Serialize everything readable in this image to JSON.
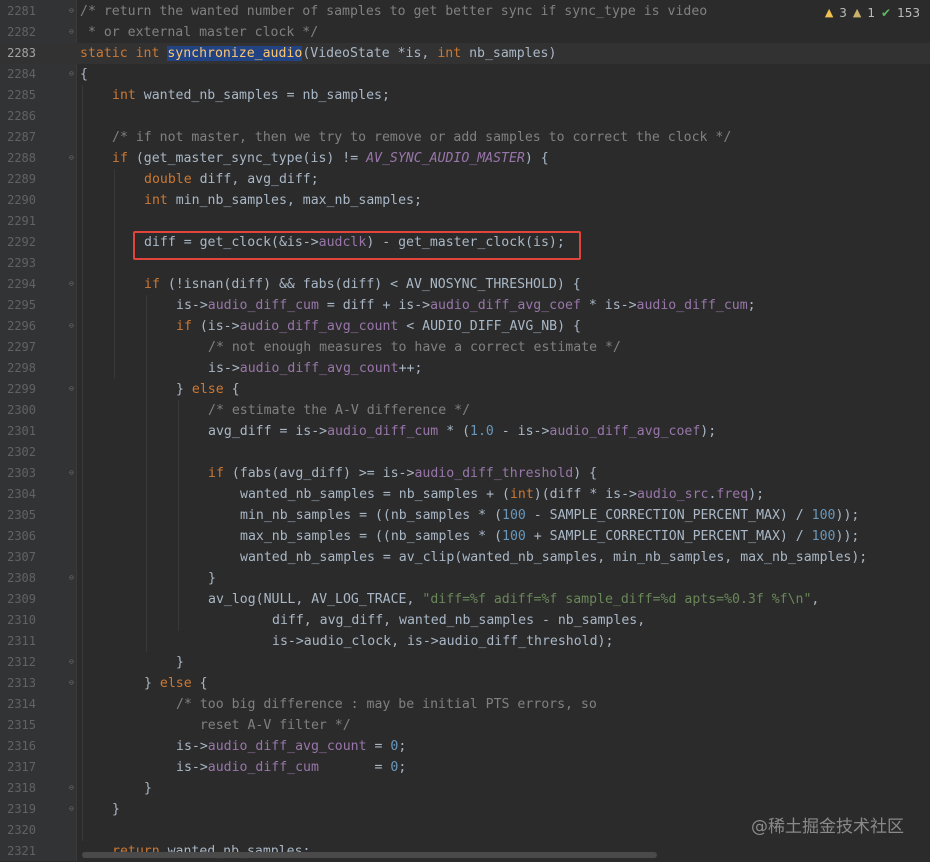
{
  "inspections": {
    "warnings": "3",
    "weak_warnings": "1",
    "typos": "153"
  },
  "watermark": "@稀土掘金技术社区",
  "lines": [
    {
      "n": "2281",
      "fold": "⊖",
      "indent": 0,
      "tokens": [
        [
          "cm",
          "/* return the wanted number of samples to get better sync if sync_type is video"
        ]
      ]
    },
    {
      "n": "2282",
      "fold": "⊖",
      "indent": 0,
      "tokens": [
        [
          "cm",
          " * or external master clock */"
        ]
      ]
    },
    {
      "n": "2283",
      "fold": "",
      "indent": 0,
      "current": true,
      "tokens": [
        [
          "kw",
          "static "
        ],
        [
          "kw",
          "int "
        ],
        [
          "hl",
          "synchronize_audio"
        ],
        [
          "",
          "(VideoState *is, "
        ],
        [
          "kw",
          "int "
        ],
        [
          "",
          "nb_samples)"
        ]
      ]
    },
    {
      "n": "2284",
      "fold": "⊖",
      "indent": 0,
      "tokens": [
        [
          "",
          "{"
        ]
      ]
    },
    {
      "n": "2285",
      "fold": "",
      "indent": 1,
      "tokens": [
        [
          "kw",
          "int "
        ],
        [
          "",
          "wanted_nb_samples = nb_samples;"
        ]
      ]
    },
    {
      "n": "2286",
      "fold": "",
      "indent": 0,
      "tokens": []
    },
    {
      "n": "2287",
      "fold": "",
      "indent": 1,
      "tokens": [
        [
          "cm",
          "/* if not master, then we try to remove or add samples to correct the clock */"
        ]
      ]
    },
    {
      "n": "2288",
      "fold": "⊖",
      "indent": 1,
      "tokens": [
        [
          "kw",
          "if "
        ],
        [
          "",
          "(get_master_sync_type(is) != "
        ],
        [
          "mac",
          "AV_SYNC_AUDIO_MASTER"
        ],
        [
          "",
          ") {"
        ]
      ]
    },
    {
      "n": "2289",
      "fold": "",
      "indent": 2,
      "tokens": [
        [
          "kw",
          "double "
        ],
        [
          "",
          "diff, avg_diff;"
        ]
      ]
    },
    {
      "n": "2290",
      "fold": "",
      "indent": 2,
      "tokens": [
        [
          "kw",
          "int "
        ],
        [
          "",
          "min_nb_samples, max_nb_samples;"
        ]
      ]
    },
    {
      "n": "2291",
      "fold": "",
      "indent": 0,
      "tokens": []
    },
    {
      "n": "2292",
      "fold": "",
      "indent": 2,
      "tokens": [
        [
          "",
          "diff = get_clock(&is->"
        ],
        [
          "fld",
          "audclk"
        ],
        [
          "",
          ") - get_master_clock(is);"
        ]
      ]
    },
    {
      "n": "2293",
      "fold": "",
      "indent": 0,
      "tokens": []
    },
    {
      "n": "2294",
      "fold": "⊖",
      "indent": 2,
      "tokens": [
        [
          "kw",
          "if "
        ],
        [
          "",
          "(!isnan(diff) && fabs(diff) < AV_NOSYNC_THRESHOLD) {"
        ]
      ]
    },
    {
      "n": "2295",
      "fold": "",
      "indent": 3,
      "tokens": [
        [
          "",
          "is->"
        ],
        [
          "fld",
          "audio_diff_cum"
        ],
        [
          "",
          " = diff + is->"
        ],
        [
          "fld",
          "audio_diff_avg_coef"
        ],
        [
          "",
          " * is->"
        ],
        [
          "fld",
          "audio_diff_cum"
        ],
        [
          "",
          ";"
        ]
      ]
    },
    {
      "n": "2296",
      "fold": "⊖",
      "indent": 3,
      "tokens": [
        [
          "kw",
          "if "
        ],
        [
          "",
          "(is->"
        ],
        [
          "fld",
          "audio_diff_avg_count"
        ],
        [
          "",
          " < AUDIO_DIFF_AVG_NB) {"
        ]
      ]
    },
    {
      "n": "2297",
      "fold": "",
      "indent": 4,
      "tokens": [
        [
          "cm",
          "/* not enough measures to have a correct estimate */"
        ]
      ]
    },
    {
      "n": "2298",
      "fold": "",
      "indent": 4,
      "tokens": [
        [
          "",
          "is->"
        ],
        [
          "fld",
          "audio_diff_avg_count"
        ],
        [
          "",
          "++;"
        ]
      ]
    },
    {
      "n": "2299",
      "fold": "⊖",
      "indent": 3,
      "tokens": [
        [
          "",
          "} "
        ],
        [
          "kw",
          "else "
        ],
        [
          "",
          "{"
        ]
      ]
    },
    {
      "n": "2300",
      "fold": "",
      "indent": 4,
      "tokens": [
        [
          "cm",
          "/* estimate the A-V difference */"
        ]
      ]
    },
    {
      "n": "2301",
      "fold": "",
      "indent": 4,
      "tokens": [
        [
          "",
          "avg_diff = is->"
        ],
        [
          "fld",
          "audio_diff_cum"
        ],
        [
          "",
          " * ("
        ],
        [
          "num",
          "1.0"
        ],
        [
          "",
          " - is->"
        ],
        [
          "fld",
          "audio_diff_avg_coef"
        ],
        [
          "",
          ");"
        ]
      ]
    },
    {
      "n": "2302",
      "fold": "",
      "indent": 0,
      "tokens": []
    },
    {
      "n": "2303",
      "fold": "⊖",
      "indent": 4,
      "tokens": [
        [
          "kw",
          "if "
        ],
        [
          "",
          "(fabs(avg_diff) >= is->"
        ],
        [
          "fld",
          "audio_diff_threshold"
        ],
        [
          "",
          ") {"
        ]
      ]
    },
    {
      "n": "2304",
      "fold": "",
      "indent": 5,
      "tokens": [
        [
          "",
          "wanted_nb_samples = nb_samples + ("
        ],
        [
          "kw",
          "int"
        ],
        [
          "",
          ")(diff * is->"
        ],
        [
          "fld",
          "audio_src"
        ],
        [
          "",
          "."
        ],
        [
          "fld",
          "freq"
        ],
        [
          "",
          ");"
        ]
      ]
    },
    {
      "n": "2305",
      "fold": "",
      "indent": 5,
      "tokens": [
        [
          "",
          "min_nb_samples = ((nb_samples * ("
        ],
        [
          "num",
          "100"
        ],
        [
          "",
          " - SAMPLE_CORRECTION_PERCENT_MAX) / "
        ],
        [
          "num",
          "100"
        ],
        [
          "",
          "));"
        ]
      ]
    },
    {
      "n": "2306",
      "fold": "",
      "indent": 5,
      "tokens": [
        [
          "",
          "max_nb_samples = ((nb_samples * ("
        ],
        [
          "num",
          "100"
        ],
        [
          "",
          " + SAMPLE_CORRECTION_PERCENT_MAX) / "
        ],
        [
          "num",
          "100"
        ],
        [
          "",
          "));"
        ]
      ]
    },
    {
      "n": "2307",
      "fold": "",
      "indent": 5,
      "tokens": [
        [
          "",
          "wanted_nb_samples = av_clip(wanted_nb_samples, min_nb_samples, max_nb_samples);"
        ]
      ]
    },
    {
      "n": "2308",
      "fold": "⊖",
      "indent": 4,
      "tokens": [
        [
          "",
          "}"
        ]
      ]
    },
    {
      "n": "2309",
      "fold": "",
      "indent": 4,
      "tokens": [
        [
          "",
          "av_log(NULL, AV_LOG_TRACE, "
        ],
        [
          "str",
          "\"diff=%f adiff=%f sample_diff=%d apts=%0.3f %f\\n\""
        ],
        [
          "",
          ","
        ]
      ]
    },
    {
      "n": "2310",
      "fold": "",
      "indent": 6,
      "tokens": [
        [
          "",
          "diff, avg_diff, wanted_nb_samples - nb_samples,"
        ]
      ]
    },
    {
      "n": "2311",
      "fold": "",
      "indent": 6,
      "tokens": [
        [
          "",
          "is->audio_clock, is->audio_diff_threshold);"
        ]
      ]
    },
    {
      "n": "2312",
      "fold": "⊖",
      "indent": 3,
      "tokens": [
        [
          "",
          "}"
        ]
      ]
    },
    {
      "n": "2313",
      "fold": "⊖",
      "indent": 2,
      "tokens": [
        [
          "",
          "} "
        ],
        [
          "kw",
          "else "
        ],
        [
          "",
          "{"
        ]
      ]
    },
    {
      "n": "2314",
      "fold": "",
      "indent": 3,
      "tokens": [
        [
          "cm",
          "/* too big difference : may be initial PTS errors, so"
        ]
      ]
    },
    {
      "n": "2315",
      "fold": "",
      "indent": 3,
      "tokens": [
        [
          "cm",
          "   reset A-V filter */"
        ]
      ]
    },
    {
      "n": "2316",
      "fold": "",
      "indent": 3,
      "tokens": [
        [
          "",
          "is->"
        ],
        [
          "fld",
          "audio_diff_avg_count"
        ],
        [
          "",
          " = "
        ],
        [
          "num",
          "0"
        ],
        [
          "",
          ";"
        ]
      ]
    },
    {
      "n": "2317",
      "fold": "",
      "indent": 3,
      "tokens": [
        [
          "",
          "is->"
        ],
        [
          "fld",
          "audio_diff_cum"
        ],
        [
          "",
          "       = "
        ],
        [
          "num",
          "0"
        ],
        [
          "",
          ";"
        ]
      ]
    },
    {
      "n": "2318",
      "fold": "⊖",
      "indent": 2,
      "tokens": [
        [
          "",
          "}"
        ]
      ]
    },
    {
      "n": "2319",
      "fold": "⊖",
      "indent": 1,
      "tokens": [
        [
          "",
          "}"
        ]
      ]
    },
    {
      "n": "2320",
      "fold": "",
      "indent": 0,
      "tokens": []
    },
    {
      "n": "2321",
      "fold": "",
      "indent": 1,
      "tokens": [
        [
          "kw",
          "return "
        ],
        [
          "",
          "wanted_nb_samples;"
        ]
      ]
    }
  ]
}
